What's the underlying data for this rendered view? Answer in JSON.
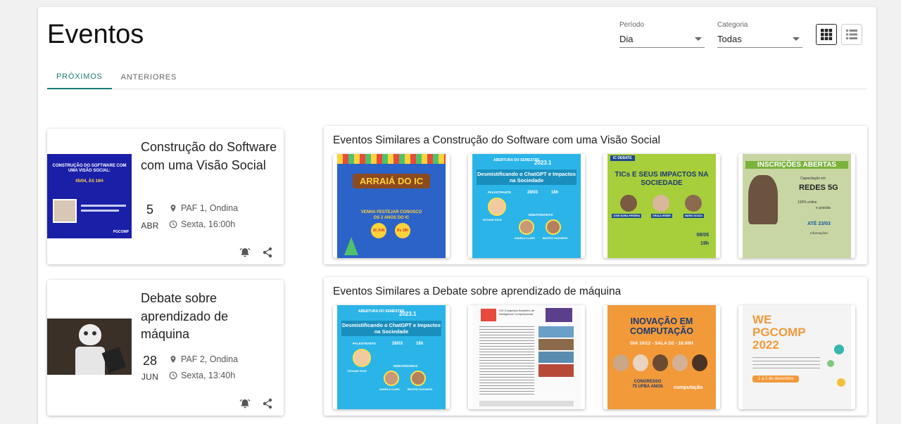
{
  "page": {
    "title": "Eventos"
  },
  "filters": {
    "period": {
      "label": "Período",
      "value": "Dia"
    },
    "category": {
      "label": "Categoria",
      "value": "Todas"
    }
  },
  "tabs": [
    {
      "label": "PRÓXIMOS",
      "active": true
    },
    {
      "label": "ANTERIORES",
      "active": false
    }
  ],
  "events": [
    {
      "title": "Construção do Software com uma Visão Social",
      "day": "5",
      "month": "ABR",
      "location": "PAF 1, Ondina",
      "time": "Sexta, 16:00h",
      "thumb": {
        "headline": "CONSTRUÇÃO DO SOFTWARE COM UMA VISÃO SOCIAL:",
        "date": "05/04, ÀS 16H",
        "brand": "PGCOMP"
      }
    },
    {
      "title": "Debate sobre aprendizado de máquina",
      "day": "28",
      "month": "JUN",
      "location": "PAF 2, Ondina",
      "time": "Sexta, 13:40h"
    }
  ],
  "similar": [
    {
      "title": "Eventos Similares a Construção do Software com uma Visão Social",
      "posters": [
        {
          "kind": "arraia",
          "headline": "ARRAIÁ DO IC",
          "sub": "VENHA FESTEJAR CONOSCO",
          "sub2": "OS 2 ANOS DO IC",
          "day": "16 JUN",
          "hour": "Às 18h"
        },
        {
          "kind": "chatgpt",
          "top": "ABERTURA DO SEMESTRE",
          "year": "2023.1",
          "headline": "Desmistificando o ChatGPT e Impactos na Sociedade",
          "date": "28/03",
          "hour": "18h",
          "speaker": "PALESTRANTE",
          "name": "TATIANE RIOS",
          "debaters": "DEBATEDORAS",
          "d1": "DANIELA CLARO",
          "d2": "BEATRIZ FAGUNDES"
        },
        {
          "kind": "tics",
          "tag": "IC DEBATE",
          "headline": "TICs E SEUS IMPACTOS NA SOCIEDADE",
          "n1": "JOSÉ MARIA PEREIRA",
          "n2": "GRAÇA HEBER",
          "n3": "MARIO SOUZA",
          "date": "08/05",
          "hour": "19h"
        },
        {
          "kind": "inscricoes",
          "headline": "INSCRIÇÕES ABERTAS",
          "sub": "Capacitação em",
          "big": "REDES 5G",
          "online": "100% online",
          "free": "e gratuita",
          "until": "ATÉ 23/03",
          "info": "Informações:"
        }
      ]
    },
    {
      "title": "Eventos Similares a Debate sobre aprendizado de máquina",
      "posters": [
        {
          "kind": "chatgpt",
          "top": "ABERTURA DO SEMESTRE",
          "year": "2023.1",
          "headline": "Desmistificando o ChatGPT e Impactos na Sociedade",
          "date": "28/03",
          "hour": "18h",
          "speaker": "PALESTRANTE",
          "name": "TATIANE RIOS",
          "debaters": "DEBATEDORAS",
          "d1": "DANIELA CLARO",
          "d2": "BEATRIZ FAGUNDES"
        },
        {
          "kind": "doc",
          "headline": "XVI Congresso Brasileiro de Inteligência Computacional"
        },
        {
          "kind": "inovacao",
          "headline": "INOVAÇÃO EM COMPUTAÇÃO",
          "sub": "DIA 10/12 - SALA D2 - 18:00H",
          "badge": "CONGRESSO 75 UFBA ANOS",
          "brand": "computação"
        },
        {
          "kind": "wepgcomp",
          "headline": "WE PGCOMP 2022",
          "date": "1 a 2 de dezembro"
        }
      ]
    }
  ],
  "colors": {
    "accent": "#1b7c73",
    "chatgpt_bg": "#2bb4e8",
    "tics_bg": "#a7ce3b",
    "inovacao_bg": "#f2993a",
    "arraia_bg": "#2b63c8"
  }
}
